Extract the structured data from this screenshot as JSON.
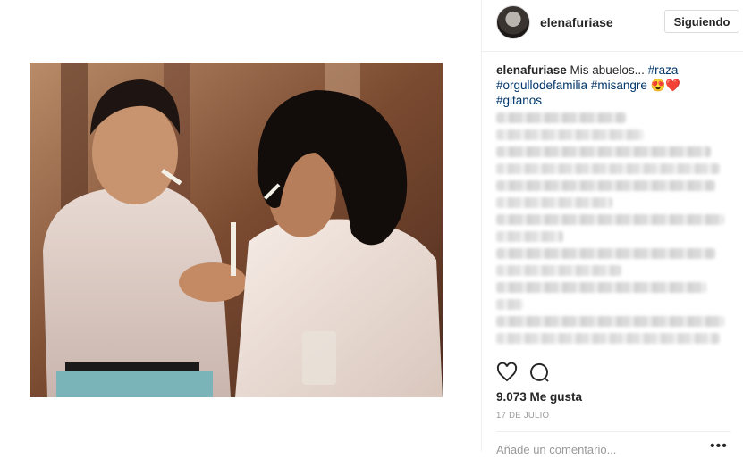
{
  "post": {
    "photo_alt": "",
    "username": "elenafuriase",
    "follow_label": "Siguiendo",
    "caption_user": "elenafuriase",
    "caption_text": " Mis abuelos... ",
    "hashtags": [
      "#raza",
      "#orgullodefamilia",
      "#misangre",
      "#gitanos"
    ],
    "emoji": "😍❤️",
    "likes_text": "9.073 Me gusta",
    "date_text": "17 DE JULIO",
    "comment_placeholder": "Añade un comentario...",
    "more_label": "•••"
  },
  "icons": {
    "like": "heart-icon",
    "comment": "comment-bubble-icon",
    "avatar": "profile-avatar"
  },
  "colors": {
    "hashtag": "#003569",
    "text": "#262626",
    "muted": "#999999",
    "border": "#dbdbdb"
  }
}
